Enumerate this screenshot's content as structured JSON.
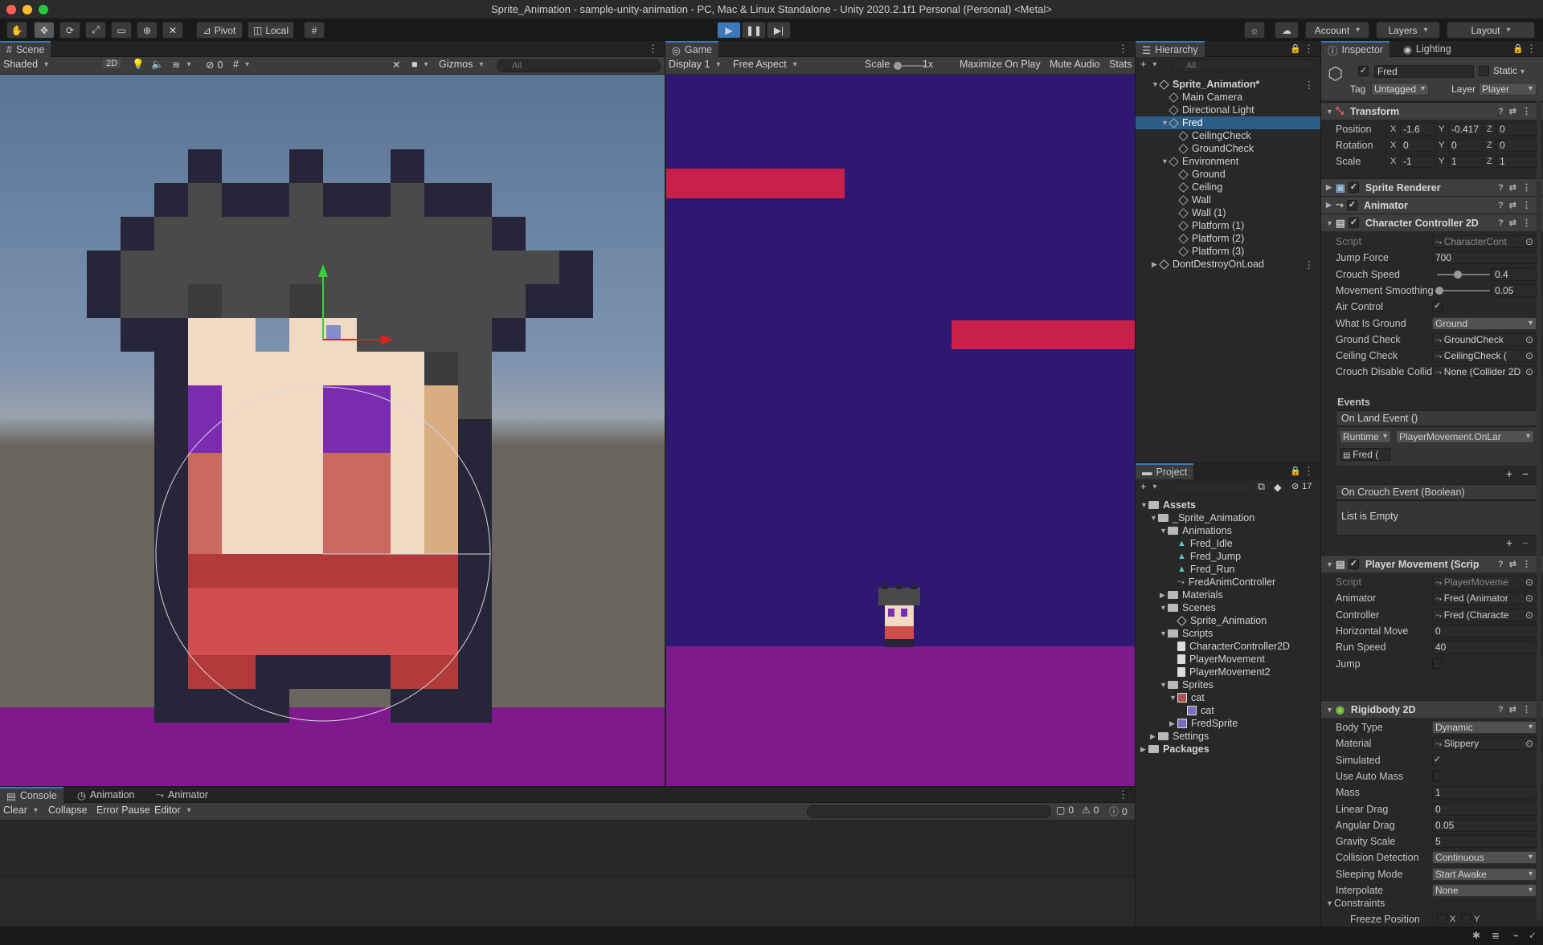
{
  "window": {
    "title": "Sprite_Animation - sample-unity-animation - PC, Mac & Linux Standalone - Unity 2020.2.1f1 Personal (Personal) <Metal>"
  },
  "toolbar": {
    "pivot": "Pivot",
    "local": "Local",
    "account": "Account",
    "layers": "Layers",
    "layout": "Layout"
  },
  "scene": {
    "tab": "Scene",
    "shading": "Shaded",
    "mode_2d": "2D",
    "hidden_count": "0",
    "gizmos": "Gizmos",
    "search_placeholder": "All"
  },
  "game": {
    "tab": "Game",
    "display": "Display 1",
    "aspect": "Free Aspect",
    "scale_label": "Scale",
    "scale_value": "1x",
    "maximize": "Maximize On Play",
    "mute": "Mute Audio",
    "stats": "Stats"
  },
  "hierarchy": {
    "tab": "Hierarchy",
    "search_placeholder": "All",
    "items": [
      {
        "label": "Sprite_Animation*",
        "depth": 0
      },
      {
        "label": "Main Camera",
        "depth": 1
      },
      {
        "label": "Directional Light",
        "depth": 1
      },
      {
        "label": "Fred",
        "depth": 1
      },
      {
        "label": "CeilingCheck",
        "depth": 2
      },
      {
        "label": "GroundCheck",
        "depth": 2
      },
      {
        "label": "Environment",
        "depth": 1
      },
      {
        "label": "Ground",
        "depth": 2
      },
      {
        "label": "Ceiling",
        "depth": 2
      },
      {
        "label": "Wall",
        "depth": 2
      },
      {
        "label": "Wall (1)",
        "depth": 2
      },
      {
        "label": "Platform (1)",
        "depth": 2
      },
      {
        "label": "Platform (2)",
        "depth": 2
      },
      {
        "label": "Platform (3)",
        "depth": 2
      },
      {
        "label": "DontDestroyOnLoad",
        "depth": 0
      }
    ]
  },
  "project": {
    "tab": "Project",
    "hidden_count": "17",
    "items": [
      {
        "label": "Assets",
        "depth": 0,
        "kind": "folder"
      },
      {
        "label": "_Sprite_Animation",
        "depth": 1,
        "kind": "folder"
      },
      {
        "label": "Animations",
        "depth": 2,
        "kind": "folder"
      },
      {
        "label": "Fred_Idle",
        "depth": 3,
        "kind": "anim"
      },
      {
        "label": "Fred_Jump",
        "depth": 3,
        "kind": "anim"
      },
      {
        "label": "Fred_Run",
        "depth": 3,
        "kind": "anim"
      },
      {
        "label": "FredAnimController",
        "depth": 3,
        "kind": "controller"
      },
      {
        "label": "Materials",
        "depth": 2,
        "kind": "folder"
      },
      {
        "label": "Scenes",
        "depth": 2,
        "kind": "folder"
      },
      {
        "label": "Sprite_Animation",
        "depth": 3,
        "kind": "scene"
      },
      {
        "label": "Scripts",
        "depth": 2,
        "kind": "folder"
      },
      {
        "label": "CharacterController2D",
        "depth": 3,
        "kind": "script"
      },
      {
        "label": "PlayerMovement",
        "depth": 3,
        "kind": "script"
      },
      {
        "label": "PlayerMovement2",
        "depth": 3,
        "kind": "script"
      },
      {
        "label": "Sprites",
        "depth": 2,
        "kind": "folder"
      },
      {
        "label": "cat",
        "depth": 3,
        "kind": "sprite"
      },
      {
        "label": "cat",
        "depth": 4,
        "kind": "subsprite"
      },
      {
        "label": "FredSprite",
        "depth": 3,
        "kind": "sprite"
      },
      {
        "label": "Settings",
        "depth": 1,
        "kind": "folder"
      },
      {
        "label": "Packages",
        "depth": 0,
        "kind": "folder"
      }
    ]
  },
  "inspector": {
    "tab": "Inspector",
    "lighting_tab": "Lighting",
    "object_name": "Fred",
    "static": "Static",
    "tag_label": "Tag",
    "tag_value": "Untagged",
    "layer_label": "Layer",
    "layer_value": "Player",
    "transform": {
      "title": "Transform",
      "position_label": "Position",
      "position": [
        "-1.6",
        "-0.417",
        "0"
      ],
      "rotation_label": "Rotation",
      "rotation": [
        "0",
        "0",
        "0"
      ],
      "scale_label": "Scale",
      "scale": [
        "-1",
        "1",
        "1"
      ]
    },
    "sprite_renderer": "Sprite Renderer",
    "animator": "Animator",
    "cc2d": {
      "title": "Character Controller 2D",
      "rows": [
        {
          "label": "Script",
          "value": "CharacterCont"
        },
        {
          "label": "Jump Force",
          "value": "700"
        },
        {
          "label": "Crouch Speed",
          "value": "0.4"
        },
        {
          "label": "Movement Smoothing",
          "value": "0.05"
        },
        {
          "label": "Air Control",
          "value": "✓"
        },
        {
          "label": "What Is Ground",
          "value": "Ground"
        },
        {
          "label": "Ground Check",
          "value": "GroundCheck"
        },
        {
          "label": "Ceiling Check",
          "value": "CeilingCheck ("
        },
        {
          "label": "Crouch Disable Collider",
          "value": "None (Collider 2D"
        }
      ],
      "crouch_speed": 0.4,
      "movement_smoothing": 0.05,
      "events_label": "Events",
      "on_land": "On Land Event ()",
      "runtime": "Runtime",
      "handler": "PlayerMovement.OnLar",
      "target": "Fred (",
      "on_crouch": "On Crouch Event (Boolean)",
      "list_empty": "List is Empty"
    },
    "player_movement": {
      "title": "Player Movement (Scrip",
      "rows": [
        {
          "label": "Script",
          "value": "PlayerMoveme"
        },
        {
          "label": "Animator",
          "value": "Fred (Animator"
        },
        {
          "label": "Controller",
          "value": "Fred (Characte"
        },
        {
          "label": "Horizontal Move",
          "value": "0"
        },
        {
          "label": "Run Speed",
          "value": "40"
        },
        {
          "label": "Jump",
          "value": ""
        }
      ]
    },
    "rigidbody": {
      "title": "Rigidbody 2D",
      "rows": [
        {
          "label": "Body Type",
          "value": "Dynamic"
        },
        {
          "label": "Material",
          "value": "Slippery"
        },
        {
          "label": "Simulated",
          "value": "✓"
        },
        {
          "label": "Use Auto Mass",
          "value": ""
        },
        {
          "label": "Mass",
          "value": "1"
        },
        {
          "label": "Linear Drag",
          "value": "0"
        },
        {
          "label": "Angular Drag",
          "value": "0.05"
        },
        {
          "label": "Gravity Scale",
          "value": "5"
        },
        {
          "label": "Collision Detection",
          "value": "Continuous"
        },
        {
          "label": "Sleeping Mode",
          "value": "Start Awake"
        },
        {
          "label": "Interpolate",
          "value": "None"
        }
      ],
      "constraints": "Constraints",
      "freeze_position": "Freeze Position",
      "freeze_x": "X",
      "freeze_y": "Y"
    }
  },
  "console": {
    "tabs": [
      "Console",
      "Animation",
      "Animator"
    ],
    "clear": "Clear",
    "collapse": "Collapse",
    "error_pause": "Error Pause",
    "editor": "Editor",
    "count_log": "0",
    "count_warn": "0",
    "count_err": "0"
  },
  "colors": {
    "accent": "#3a79bb",
    "selection": "#2c5d87",
    "game_bg": "#2e1872",
    "platform": "#c8204a",
    "ground": "#7e1a8c"
  }
}
